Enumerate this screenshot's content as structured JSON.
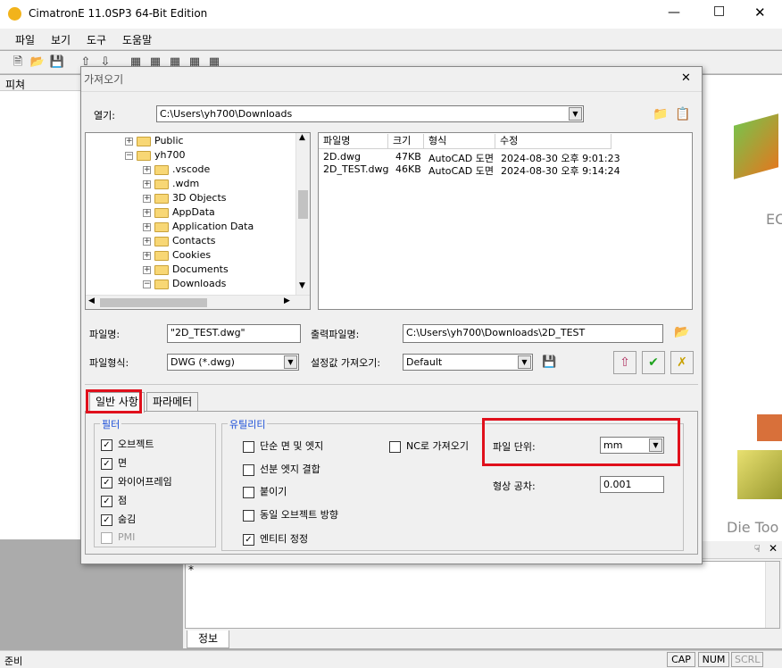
{
  "app": {
    "title": "CimatronE 11.0SP3 64-Bit Edition",
    "menu": [
      "파일",
      "보기",
      "도구",
      "도움말"
    ],
    "left_panel_title": "피쳐",
    "status": {
      "text": "준비",
      "cap": "CAP",
      "num": "NUM",
      "scrl": "SCRL"
    },
    "bottom_tab": "정보",
    "bottom_prompt": "*",
    "bg_texts": {
      "top": "EC",
      "bottom": "Die Too"
    }
  },
  "dialog": {
    "title": "가져오기",
    "open_label": "열기:",
    "open_path": "C:\\Users\\yh700\\Downloads",
    "tree": [
      {
        "label": "Public",
        "indent": 1,
        "expander": "+"
      },
      {
        "label": "yh700",
        "indent": 1,
        "expander": "-"
      },
      {
        "label": ".vscode",
        "indent": 2,
        "expander": "+"
      },
      {
        "label": ".wdm",
        "indent": 2,
        "expander": "+"
      },
      {
        "label": "3D Objects",
        "indent": 2,
        "expander": "+"
      },
      {
        "label": "AppData",
        "indent": 2,
        "expander": "+"
      },
      {
        "label": "Application Data",
        "indent": 2,
        "expander": "+"
      },
      {
        "label": "Contacts",
        "indent": 2,
        "expander": "+"
      },
      {
        "label": "Cookies",
        "indent": 2,
        "expander": "+"
      },
      {
        "label": "Documents",
        "indent": 2,
        "expander": "+"
      },
      {
        "label": "Downloads",
        "indent": 2,
        "expander": "-"
      }
    ],
    "file_columns": [
      "파일명",
      "크기",
      "형식",
      "수정"
    ],
    "files": [
      {
        "name": "2D.dwg",
        "size": "47KB",
        "type": "AutoCAD 도면",
        "modified": "2024-08-30 오후 9:01:23"
      },
      {
        "name": "2D_TEST.dwg",
        "size": "46KB",
        "type": "AutoCAD 도면",
        "modified": "2024-08-30 오후 9:14:24"
      }
    ],
    "filename_label": "파일명:",
    "filename_value": "\"2D_TEST.dwg\"",
    "output_label": "출력파일명:",
    "output_value": "C:\\Users\\yh700\\Downloads\\2D_TEST",
    "filetype_label": "파일형식:",
    "filetype_value": "DWG (*.dwg)",
    "settings_label": "설정값 가져오기:",
    "settings_value": "Default",
    "tabs": [
      "일반 사항",
      "파라메터"
    ],
    "filter": {
      "title": "필터",
      "items": [
        {
          "label": "오브젝트",
          "checked": true
        },
        {
          "label": "면",
          "checked": true
        },
        {
          "label": "와이어프레임",
          "checked": true
        },
        {
          "label": "점",
          "checked": true
        },
        {
          "label": "숨김",
          "checked": true
        },
        {
          "label": "PMI",
          "checked": false
        }
      ]
    },
    "utility": {
      "title": "유틸리티",
      "items": [
        {
          "label": "단순 면 및 엣지",
          "checked": false
        },
        {
          "label": "선분 엣지 결합",
          "checked": false
        },
        {
          "label": "붙이기",
          "checked": false
        },
        {
          "label": "동일 오브젝트 방향",
          "checked": false
        },
        {
          "label": "엔티티 정정",
          "checked": true
        }
      ],
      "nc_label": "NC로 가져오기",
      "nc_checked": false
    },
    "unit_label": "파일 단위:",
    "unit_value": "mm",
    "tolerance_label": "형상 공차:",
    "tolerance_value": "0.001"
  },
  "colors": {
    "highlight": "#e0101c",
    "group_title": "#1c4fd8"
  }
}
